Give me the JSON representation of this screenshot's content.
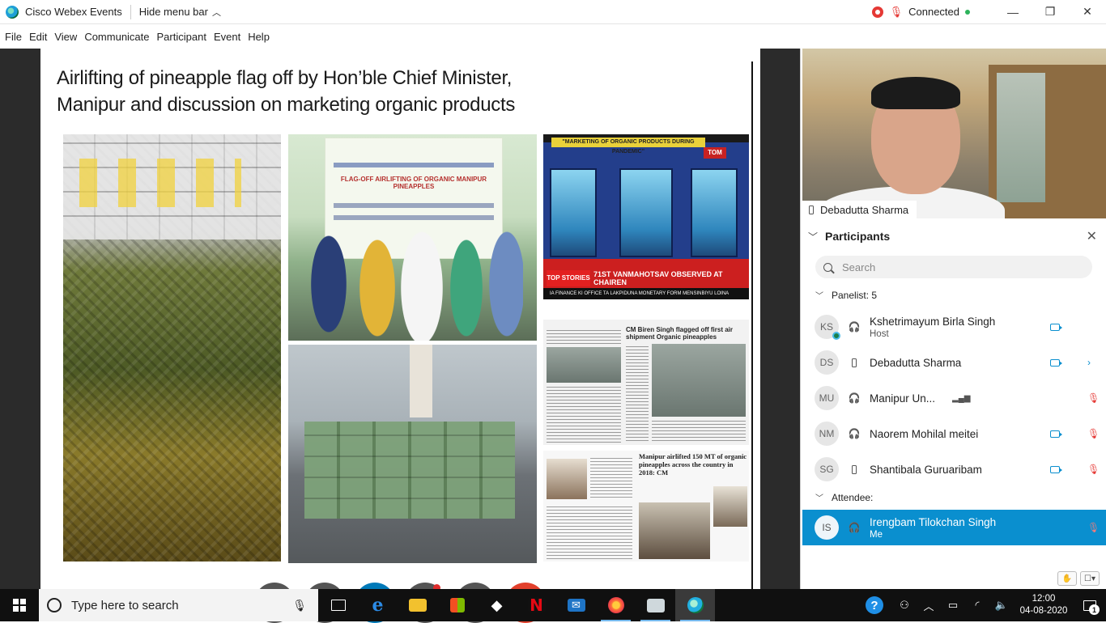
{
  "titlebar": {
    "app_title": "Cisco Webex Events",
    "hide_menu_label": "Hide menu bar",
    "connection_label": "Connected",
    "connection_color": "#2db25b"
  },
  "menu": {
    "items": [
      {
        "label": "File"
      },
      {
        "label": "Edit"
      },
      {
        "label": "View"
      },
      {
        "label": "Communicate"
      },
      {
        "label": "Participant"
      },
      {
        "label": "Event"
      },
      {
        "label": "Help"
      }
    ]
  },
  "slide": {
    "title": "Airlifting of pineapple flag off by Hon’ble Chief Minister, Manipur and discussion on marketing organic products",
    "flagoff_banner_text": "FLAG-OFF AIRLIFTING OF ORGANIC MANIPUR PINEAPPLES",
    "tv_ticker": "\"MARKETING OF ORGANIC PRODUCTS DURING PANDEMIC\"",
    "tv_logo": "TOM",
    "tv_top_stories": "TOP STORIES",
    "tv_lower_headline": "71ST VANMAHOTSAV OBSERVED AT CHAIREN",
    "tv_lower_strip": "IA FINANCE KI OFFICE TA LAKPIDUNA MONETARY FORM MENSINBIYU LOINA",
    "news1_headline": "CM Biren Singh flagged off first air shipment Organic pineapples",
    "news2_headline": "Manipur airlifted 150 MT of organic pineapples across the country in 2018: CM"
  },
  "controls": {
    "buttons": [
      {
        "name": "mute-button",
        "icon": "mic-muted-icon",
        "glyph": "🎙"
      },
      {
        "name": "share-button",
        "icon": "share-icon",
        "glyph": "⇪"
      },
      {
        "name": "participants-button",
        "icon": "participants-icon",
        "glyph": "👤"
      },
      {
        "name": "chat-button",
        "icon": "chat-icon",
        "glyph": "💬"
      },
      {
        "name": "more-button",
        "icon": "more-icon",
        "glyph": "···"
      },
      {
        "name": "leave-button",
        "icon": "close-icon",
        "glyph": "✕"
      }
    ]
  },
  "video": {
    "speaker_name": "Debadutta Sharma"
  },
  "participants": {
    "title": "Participants",
    "search_placeholder": "Search",
    "panelist_header": "Panelist: 5",
    "attendee_header": "Attendee:",
    "panelists": [
      {
        "initials": "KS",
        "name": "Kshetrimayum Birla Singh",
        "role": "Host",
        "conn": "headset"
      },
      {
        "initials": "DS",
        "name": "Debadutta Sharma",
        "role": "",
        "conn": "phone"
      },
      {
        "initials": "MU",
        "name": "Manipur Un...",
        "role": "",
        "conn": "headset"
      },
      {
        "initials": "NM",
        "name": "Naorem Mohilal meitei",
        "role": "",
        "conn": "headset"
      },
      {
        "initials": "SG",
        "name": "Shantibala Guruaribam",
        "role": "",
        "conn": "phone"
      }
    ],
    "attendees": [
      {
        "initials": "IS",
        "name": "Irengbam Tilokchan Singh",
        "role": "Me",
        "conn": "headset"
      }
    ],
    "accent_color": "#0a8fcf"
  },
  "taskbar": {
    "search_placeholder": "Type here to search",
    "time": "12:00",
    "date": "04-08-2020",
    "notification_count": "1"
  }
}
